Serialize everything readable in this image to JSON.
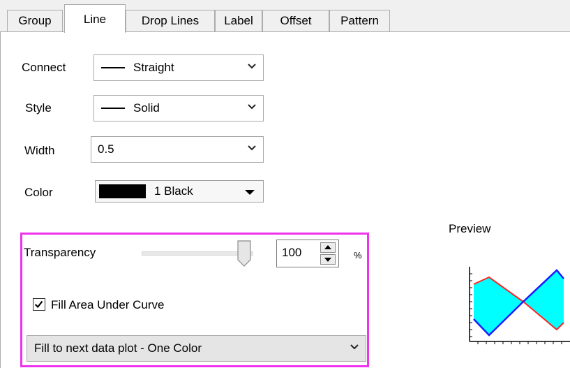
{
  "tabs": [
    "Group",
    "Line",
    "Drop Lines",
    "Label",
    "Offset",
    "Pattern"
  ],
  "active_tab": "Line",
  "connect": {
    "label": "Connect",
    "value": "Straight"
  },
  "style": {
    "label": "Style",
    "value": "Solid"
  },
  "width": {
    "label": "Width",
    "value": "0.5"
  },
  "color": {
    "label": "Color",
    "value": "1 Black",
    "swatch": "#000000"
  },
  "transparency": {
    "label": "Transparency",
    "value": "100",
    "unit": "%",
    "slider_fraction": 1.0
  },
  "fill_area": {
    "label": "Fill Area Under Curve",
    "checked": true
  },
  "fill_mode": {
    "value": "Fill to next data plot - One Color"
  },
  "preview": {
    "label": "Preview",
    "line1_color": "#ff2222",
    "line2_color": "#1a1aff",
    "fill_color": "#00ffff"
  },
  "highlight_color": "#ee33ee"
}
